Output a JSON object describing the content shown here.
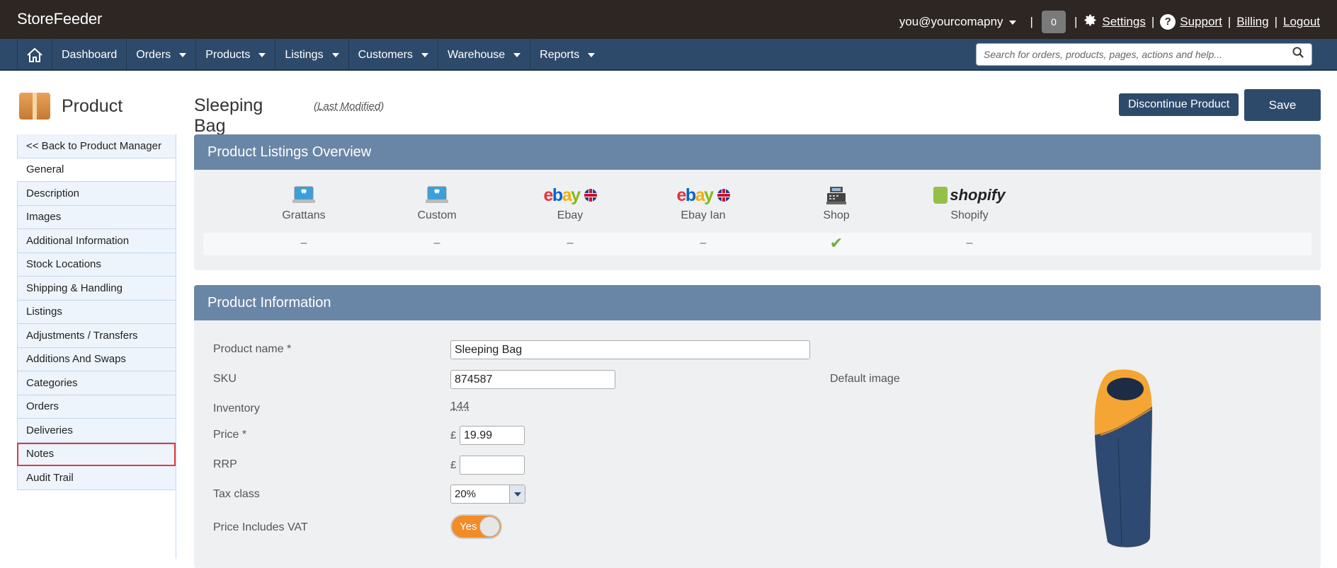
{
  "app": {
    "brand": "StoreFeeder"
  },
  "topbar": {
    "user": "you@yourcomapny",
    "badge_count": "0",
    "settings": "Settings",
    "support": "Support",
    "billing": "Billing",
    "logout": "Logout"
  },
  "nav": {
    "items": [
      "Dashboard",
      "Orders",
      "Products",
      "Listings",
      "Customers",
      "Warehouse",
      "Reports"
    ],
    "search_placeholder": "Search for orders, products, pages, actions and help..."
  },
  "sidebar": {
    "title": "Product",
    "items": [
      "<< Back to Product Manager",
      "General",
      "Description",
      "Images",
      "Additional Information",
      "Stock Locations",
      "Shipping & Handling",
      "Listings",
      "Adjustments / Transfers",
      "Additions And Swaps",
      "Categories",
      "Orders",
      "Deliveries",
      "Notes",
      "Audit Trail"
    ]
  },
  "header": {
    "product_title": "Sleeping Bag",
    "last_modified": "(Last Modified)",
    "discontinue_label": "Discontinue Product",
    "save_label": "Save"
  },
  "listings_overview": {
    "title": "Product Listings Overview",
    "channels": [
      {
        "name": "Grattans",
        "icon": "laptop-icon",
        "status": "–"
      },
      {
        "name": "Custom",
        "icon": "laptop-icon",
        "status": "–"
      },
      {
        "name": "Ebay",
        "icon": "ebay-logo",
        "status": "–"
      },
      {
        "name": "Ebay Ian",
        "icon": "ebay-logo",
        "status": "–"
      },
      {
        "name": "Shop",
        "icon": "cash-register-icon",
        "status": "✔"
      },
      {
        "name": "Shopify",
        "icon": "shopify-logo",
        "status": "–"
      }
    ],
    "ebay_logo_text": "ebay",
    "shopify_logo_text": "shopify",
    "colors": {
      "check": "#6db33f",
      "shopify_green": "#95bf47"
    }
  },
  "product_info": {
    "title": "Product Information",
    "labels": {
      "name": "Product name *",
      "sku": "SKU",
      "inventory": "Inventory",
      "price": "Price *",
      "rrp": "RRP",
      "tax_class": "Tax class",
      "price_includes_vat": "Price Includes VAT",
      "default_image": "Default image"
    },
    "values": {
      "name": "Sleeping Bag",
      "sku": "874587",
      "inventory": "144",
      "currency": "£",
      "price": "19.99",
      "rrp": "",
      "tax_class": "20%",
      "vat_toggle": "Yes"
    }
  },
  "colors": {
    "topbar": "#2d2623",
    "nav": "#2e4a6b",
    "panel_head": "#6a86a6",
    "toggle_on": "#f28c28",
    "highlight": "#e03c3c"
  }
}
